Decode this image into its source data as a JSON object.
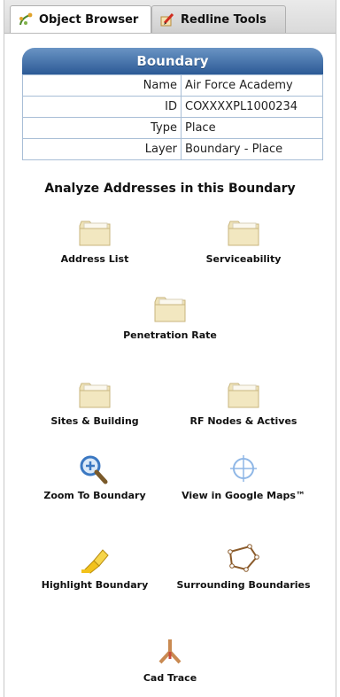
{
  "tabs": [
    {
      "label": "Object Browser",
      "active": true
    },
    {
      "label": "Redline Tools",
      "active": false
    }
  ],
  "panel": {
    "title": "Boundary",
    "fields": [
      {
        "key": "Name",
        "value": "Air Force Academy"
      },
      {
        "key": "ID",
        "value": "COXXXXPL1000234"
      },
      {
        "key": "Type",
        "value": "Place"
      },
      {
        "key": "Layer",
        "value": "Boundary - Place"
      }
    ]
  },
  "analyze": {
    "title": "Analyze Addresses in this Boundary",
    "actions": [
      {
        "label": "Address List",
        "icon": "folder-icon"
      },
      {
        "label": "Serviceability",
        "icon": "folder-icon"
      },
      {
        "label": "Penetration Rate",
        "icon": "folder-icon"
      },
      {
        "label": "Sites & Building",
        "icon": "folder-icon"
      },
      {
        "label": "RF Nodes & Actives",
        "icon": "folder-icon"
      },
      {
        "label": "Zoom To Boundary",
        "icon": "zoom-icon"
      },
      {
        "label": "View in Google Maps™",
        "icon": "crosshair-icon"
      },
      {
        "label": "Highlight Boundary",
        "icon": "highlighter-icon"
      },
      {
        "label": "Surrounding Boundaries",
        "icon": "polygon-icon"
      },
      {
        "label": "Cad Trace",
        "icon": "trace-icon"
      }
    ]
  },
  "colors": {
    "header_top": "#6a94c4",
    "header_bottom": "#2c5a96",
    "folder": "#efe3b8",
    "zoom_blue": "#3b78c2",
    "highlighter": "#f2c21b"
  }
}
